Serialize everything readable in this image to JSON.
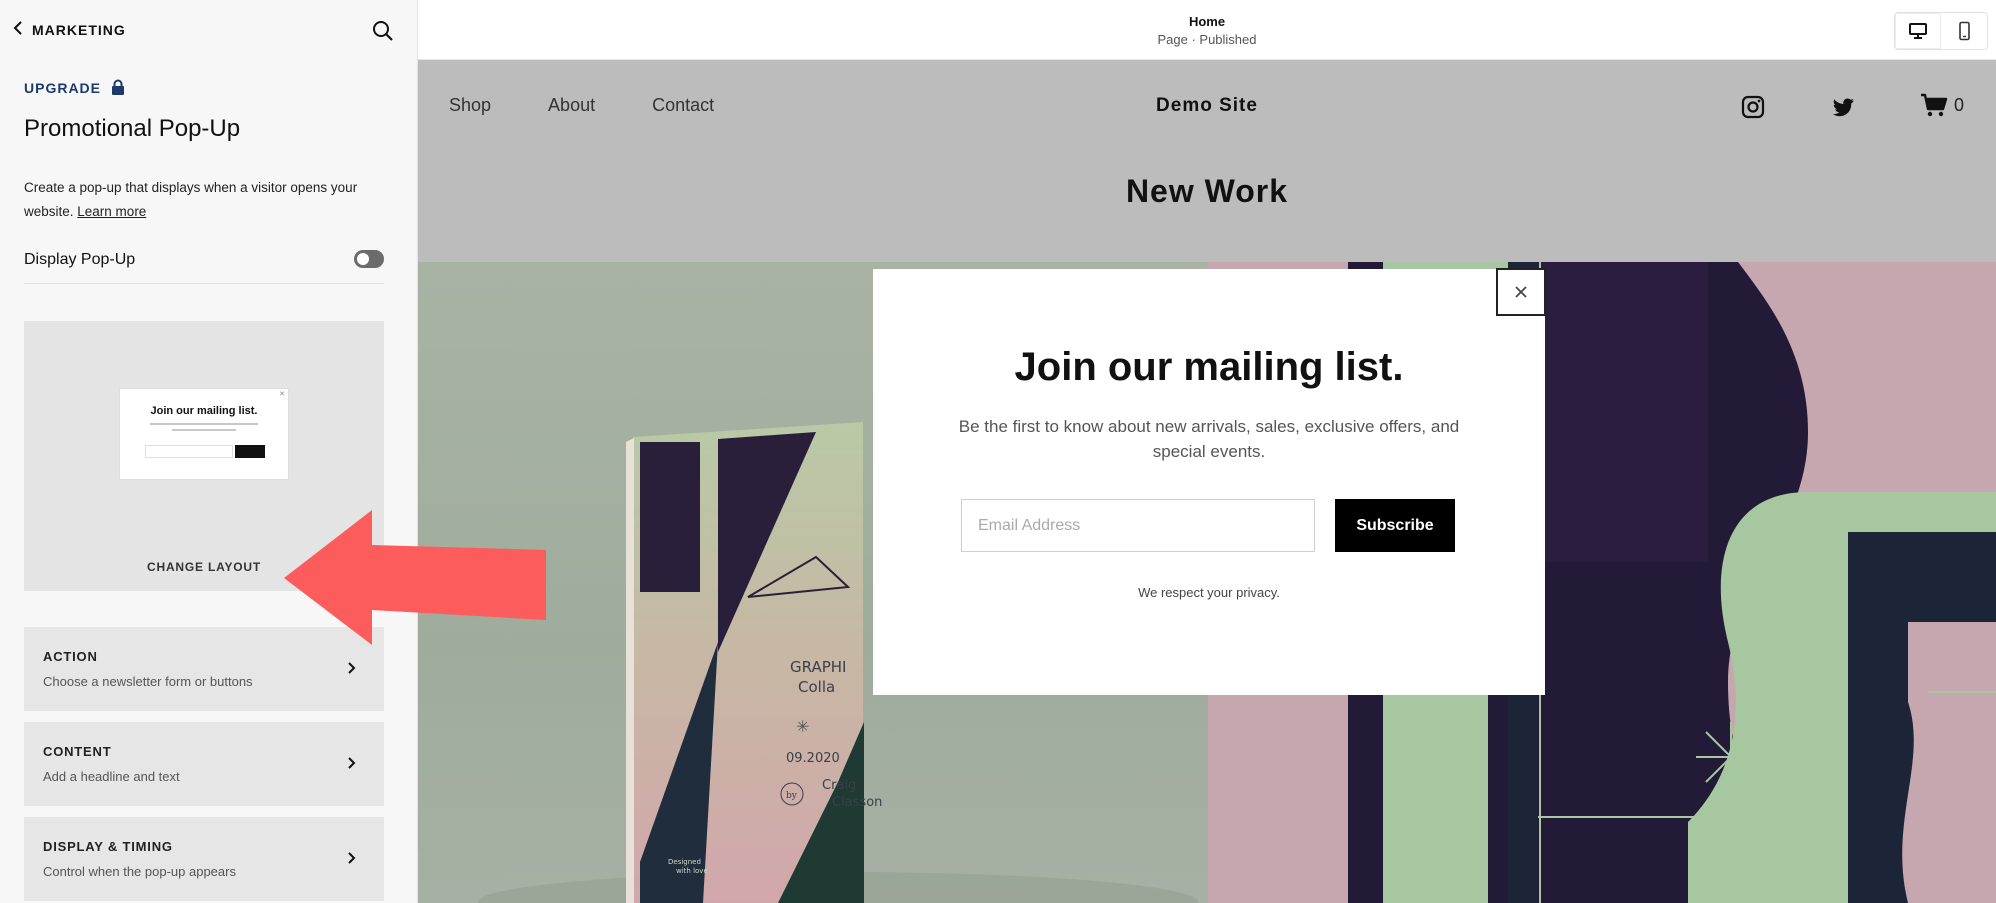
{
  "panel": {
    "back_label": "MARKETING",
    "upgrade_label": "UPGRADE",
    "title": "Promotional Pop-Up",
    "description": "Create a pop-up that displays when a visitor opens your website. ",
    "learn_more": "Learn more",
    "display_popup_label": "Display Pop-Up",
    "display_popup_on": false,
    "layout_preview": {
      "title": "Join our mailing list."
    },
    "change_layout_label": "CHANGE LAYOUT",
    "menu": [
      {
        "title": "ACTION",
        "subtitle": "Choose a newsletter form or buttons"
      },
      {
        "title": "CONTENT",
        "subtitle": "Add a headline and text"
      },
      {
        "title": "DISPLAY & TIMING",
        "subtitle": "Control when the pop-up appears"
      }
    ]
  },
  "topbar": {
    "page_name": "Home",
    "page_status": "Page · Published",
    "active_view": "desktop"
  },
  "site": {
    "nav": [
      "Shop",
      "About",
      "Contact"
    ],
    "logo": "Demo Site",
    "cart_count": "0",
    "section_title": "New Work"
  },
  "popup": {
    "title": "Join our mailing list.",
    "text": "Be the first to know about new arrivals, sales, exclusive offers, and special events.",
    "email_placeholder": "Email Address",
    "button_label": "Subscribe",
    "privacy": "We respect your privacy."
  },
  "artwork": {
    "book_title_1": "GRAPHI",
    "book_title_2": "Colla",
    "book_date": "09.2020",
    "book_author_1": "Craig",
    "book_author_2": "Classon",
    "book_badge": "by",
    "book_footer_1": "Designed",
    "book_footer_2": "with love"
  },
  "colors": {
    "upgrade": "#1d3a6b",
    "annotation_arrow": "#fd5c5c",
    "popup_button": "#000000",
    "art_dark": "#221a37",
    "art_green": "#a7c7a1"
  }
}
